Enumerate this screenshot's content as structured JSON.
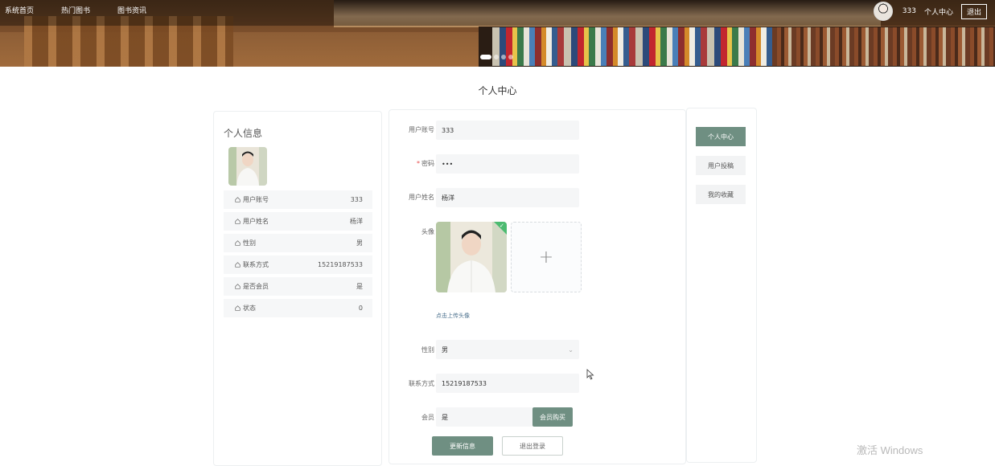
{
  "nav": {
    "items": [
      "系统首页",
      "热门图书",
      "图书资讯"
    ]
  },
  "user": {
    "name": "333",
    "center_link": "个人中心",
    "logout": "退出"
  },
  "page_title": "个人中心",
  "info": {
    "heading": "个人信息",
    "rows": [
      {
        "label": "用户账号",
        "value": "333"
      },
      {
        "label": "用户姓名",
        "value": "杨洋"
      },
      {
        "label": "性别",
        "value": "男"
      },
      {
        "label": "联系方式",
        "value": "15219187533"
      },
      {
        "label": "是否会员",
        "value": "是"
      },
      {
        "label": "状态",
        "value": "0"
      }
    ]
  },
  "form": {
    "account_label": "用户账号",
    "account_value": "333",
    "password_required": "*",
    "password_label": "密码",
    "password_value": "•••",
    "name_label": "用户姓名",
    "name_value": "杨洋",
    "avatar_label": "头像",
    "upload_plus": "+",
    "upload_tip": "点击上传头像",
    "gender_label": "性别",
    "gender_value": "男",
    "phone_label": "联系方式",
    "phone_value": "15219187533",
    "member_label": "会员",
    "member_value": "是",
    "buy_button": "会员购买",
    "update_button": "更新信息",
    "logout_button": "退出登录"
  },
  "side_menu": {
    "items": [
      "个人中心",
      "用户投稿",
      "我的收藏"
    ]
  },
  "watermark": "激活 Windows",
  "colors": {
    "accent": "#6f8f82",
    "required": "#e84d4d",
    "input_bg": "#f5f6f7"
  }
}
